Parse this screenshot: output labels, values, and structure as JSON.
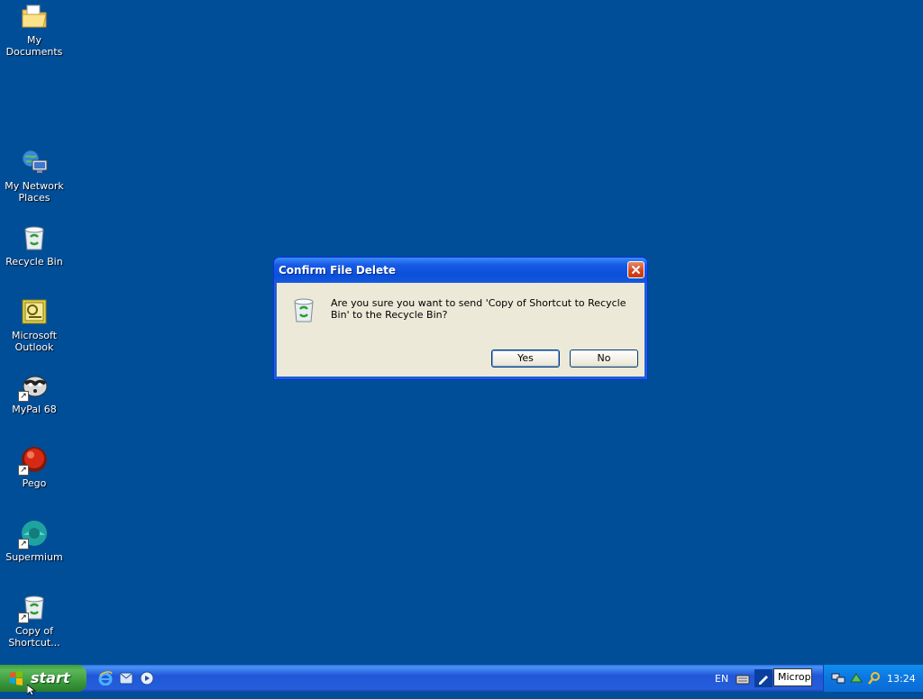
{
  "desktop": {
    "icons": [
      {
        "label": "My Documents",
        "icon": "folder-documents-icon"
      },
      {
        "label": "My Network Places",
        "icon": "network-places-icon"
      },
      {
        "label": "Recycle Bin",
        "icon": "recycle-bin-icon"
      },
      {
        "label": "Microsoft Outlook",
        "icon": "outlook-icon"
      },
      {
        "label": "MyPal 68",
        "icon": "mypal-raccoon-icon"
      },
      {
        "label": "Pego",
        "icon": "pego-icon"
      },
      {
        "label": "Supermium",
        "icon": "supermium-icon"
      },
      {
        "label": "Copy of Shortcut...",
        "icon": "recycle-bin-shortcut-icon"
      }
    ],
    "background_color": "#004e98"
  },
  "dialog": {
    "title": "Confirm File Delete",
    "message": "Are you sure you want to send 'Copy of Shortcut to Recycle Bin' to the Recycle Bin?",
    "yes_label": "Yes",
    "no_label": "No"
  },
  "taskbar": {
    "start_label": "start",
    "language": "EN",
    "input_box_value": "Microph",
    "clock": "13:24"
  }
}
